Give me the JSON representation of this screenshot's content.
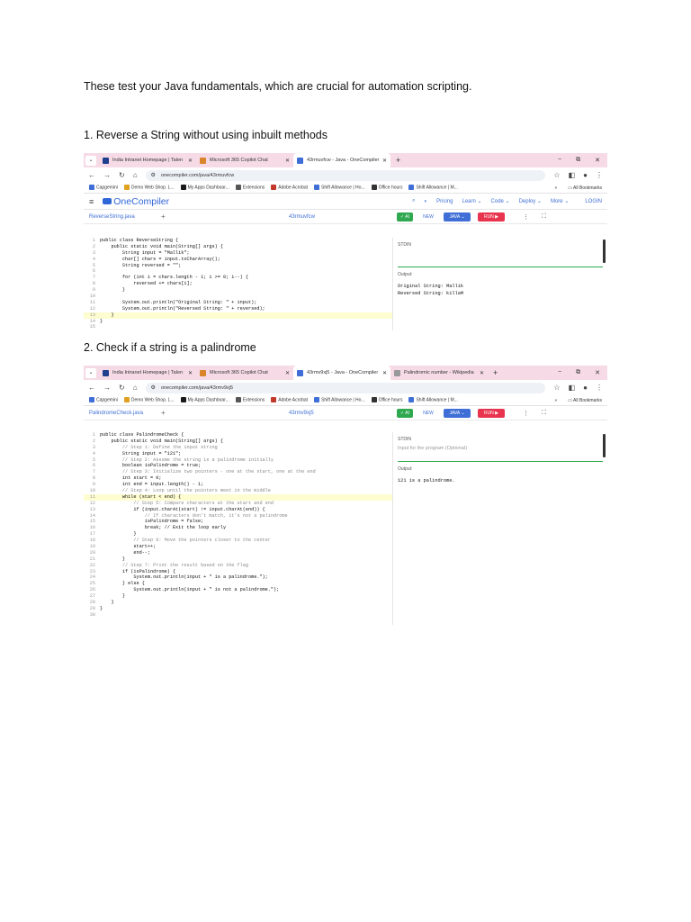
{
  "intro": "These test your Java fundamentals, which are crucial for automation scripting.",
  "heading1": "1. Reverse a String without using inbuilt methods",
  "heading2": "2. Check if a string is a palindrome",
  "browser": {
    "tabs": [
      {
        "label": "India Intranet Homepage | Talen",
        "fav": "#1f3f8f"
      },
      {
        "label": "Microsoft 365 Copilot Chat",
        "fav": "#d9862b"
      },
      {
        "label": "43rmuvfcw - Java - OneCompiler",
        "fav": "#3f6fd6"
      }
    ],
    "tabs2": [
      {
        "label": "India Intranet Homepage | Talen",
        "fav": "#1f3f8f"
      },
      {
        "label": "Microsoft 365 Copilot Chat",
        "fav": "#d9862b"
      },
      {
        "label": "43rmv9xj5 - Java - OneCompiler",
        "fav": "#3f6fd6"
      },
      {
        "label": "Palindromic number - Wikipedia",
        "fav": "#999999"
      }
    ],
    "url1": "onecompiler.com/java/43rmuvfcw",
    "url2": "onecompiler.com/java/43rmv9xj5",
    "bookmarks": [
      "Capgemini",
      "Demo Web Shop. L...",
      "My Apps Dashboar...",
      "Extensions",
      "Adobe Acrobat",
      "Shift Allowance | Ho...",
      "Office hours",
      "Shift Allowance | M..."
    ],
    "all_bookmarks": "All Bookmarks"
  },
  "onecompiler": {
    "logo": "OneCompiler",
    "nav": [
      "Pricing",
      "Learn ⌄",
      "Code ⌄",
      "Deploy ⌄",
      "More ⌄"
    ],
    "login": "LOGIN",
    "ai": "✓ AI",
    "new": "NEW",
    "java": "JAVA ⌄",
    "run": "RUN ▶",
    "stdin": "STDIN",
    "stdin_placeholder": "Input for the program (Optional)",
    "output_label": "Output:"
  },
  "shot1": {
    "file": "ReverseString.java",
    "id": "43rmuvfcw",
    "output": "Original String: Mallik\nReversed String: killaM",
    "code": [
      "public class ReverseString {",
      "    public static void main(String[] args) {",
      "        String input = \"Mallik\";",
      "        char[] chars = input.toCharArray();",
      "        String reversed = \"\";",
      "",
      "        for (int i = chars.length - 1; i >= 0; i--) {",
      "            reversed += chars[i];",
      "        }",
      "",
      "        System.out.println(\"Original String: \" + input);",
      "        System.out.println(\"Reversed String: \" + reversed);",
      "    }",
      "}",
      ""
    ]
  },
  "shot2": {
    "file": "PalindromeCheck.java",
    "id": "43rmv9xj5",
    "output": "121 is a palindrome.",
    "code": [
      "public class PalindromeCheck {",
      "    public static void main(String[] args) {",
      "        // Step 1: Define the input string",
      "        String input = \"121\";",
      "        // Step 2: Assume the string is a palindrome initially",
      "        boolean isPalindrome = true;",
      "        // Step 3: Initialize two pointers - one at the start, one at the end",
      "        int start = 0;",
      "        int end = input.length() - 1;",
      "        // Step 4: Loop until the pointers meet in the middle",
      "        while (start < end) {",
      "            // Step 5: Compare characters at the start and end",
      "            if (input.charAt(start) != input.charAt(end)) {",
      "                // If characters don't match, it's not a palindrome",
      "                isPalindrome = false;",
      "                break; // Exit the loop early",
      "            }",
      "            // Step 6: Move the pointers closer to the center",
      "            start++;",
      "            end--;",
      "        }",
      "        // Step 7: Print the result based on the flag",
      "        if (isPalindrome) {",
      "            System.out.println(input + \" is a palindrome.\");",
      "        } else {",
      "            System.out.println(input + \" is not a palindrome.\");",
      "        }",
      "    }",
      "}",
      ""
    ]
  }
}
